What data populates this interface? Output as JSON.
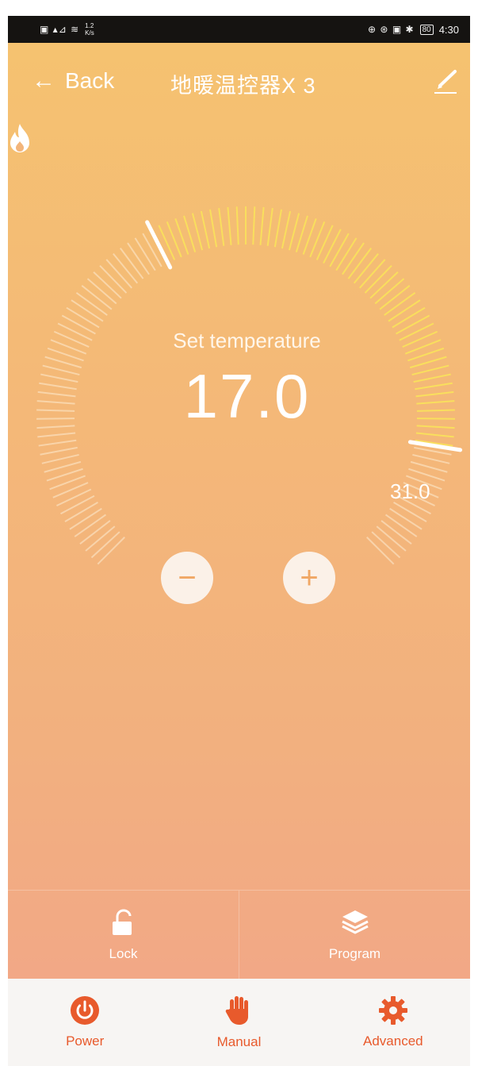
{
  "status_bar": {
    "left_glyphs": "▣ ▴⊿ ≋",
    "speed_top": "1.2",
    "speed_bottom": "K/s",
    "right_glyphs": "⊕ ⊛ ▣ ✱",
    "battery": "80",
    "time": "4:30"
  },
  "nav": {
    "back_label": "Back",
    "title": "地暖温控器X 3"
  },
  "thermostat": {
    "set_label": "Set temperature",
    "set_value": "17.0",
    "max_label": "31.0",
    "min_value": 5,
    "max_value": 35,
    "setpoint": 17.0,
    "current": 31.0,
    "active_color": "#f9e05c",
    "inactive_color": "#fbe7cc",
    "mode_icon": "flame-icon"
  },
  "controls": {
    "minus_symbol": "−",
    "plus_symbol": "+"
  },
  "quick_actions": [
    {
      "label": "Lock",
      "icon": "unlock-icon"
    },
    {
      "label": "Program",
      "icon": "layers-icon"
    }
  ],
  "tabs": [
    {
      "label": "Power",
      "icon": "power-icon"
    },
    {
      "label": "Manual",
      "icon": "hand-icon"
    },
    {
      "label": "Advanced",
      "icon": "gear-icon"
    }
  ],
  "colors": {
    "accent": "#e85a2c",
    "gradient_top": "#f5c270",
    "gradient_bottom": "#f2a886"
  }
}
